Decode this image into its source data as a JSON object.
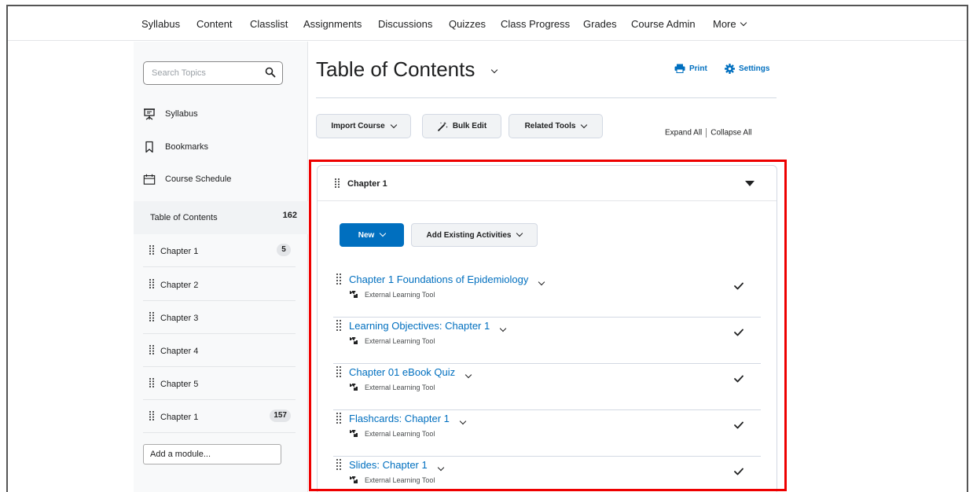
{
  "nav": {
    "items": [
      "Syllabus",
      "Content",
      "Classlist",
      "Assignments",
      "Discussions",
      "Quizzes",
      "Class Progress",
      "Grades",
      "Course Admin",
      "More"
    ]
  },
  "sidebar": {
    "search_placeholder": "Search Topics",
    "links": [
      "Syllabus",
      "Bookmarks",
      "Course Schedule"
    ],
    "toc": {
      "label": "Table of Contents",
      "count": "162"
    },
    "modules": [
      {
        "label": "Chapter 1",
        "count": "5"
      },
      {
        "label": "Chapter 2",
        "count": ""
      },
      {
        "label": "Chapter 3",
        "count": ""
      },
      {
        "label": "Chapter 4",
        "count": ""
      },
      {
        "label": "Chapter 5",
        "count": ""
      },
      {
        "label": "Chapter 1",
        "count": "157"
      }
    ],
    "add_module": "Add a module..."
  },
  "main": {
    "title": "Table of Contents",
    "print_label": "Print",
    "settings_label": "Settings",
    "toolbar": {
      "import_label": "Import Course",
      "bulk_edit_label": "Bulk Edit",
      "related_tools_label": "Related Tools",
      "expand_all": "Expand All",
      "collapse_all": "Collapse All"
    },
    "module": {
      "title": "Chapter 1",
      "new_label": "New",
      "add_existing_label": "Add Existing Activities",
      "topics": [
        {
          "name": "Chapter 1 Foundations of Epidemiology",
          "type": "External Learning Tool"
        },
        {
          "name": "Learning Objectives: Chapter 1",
          "type": "External Learning Tool"
        },
        {
          "name": "Chapter 01 eBook Quiz",
          "type": "External Learning Tool"
        },
        {
          "name": "Flashcards: Chapter 1",
          "type": "External Learning Tool"
        },
        {
          "name": "Slides: Chapter 1",
          "type": "External Learning Tool"
        }
      ]
    }
  },
  "colors": {
    "accent": "#006fbf",
    "highlight": "#ee0000"
  }
}
